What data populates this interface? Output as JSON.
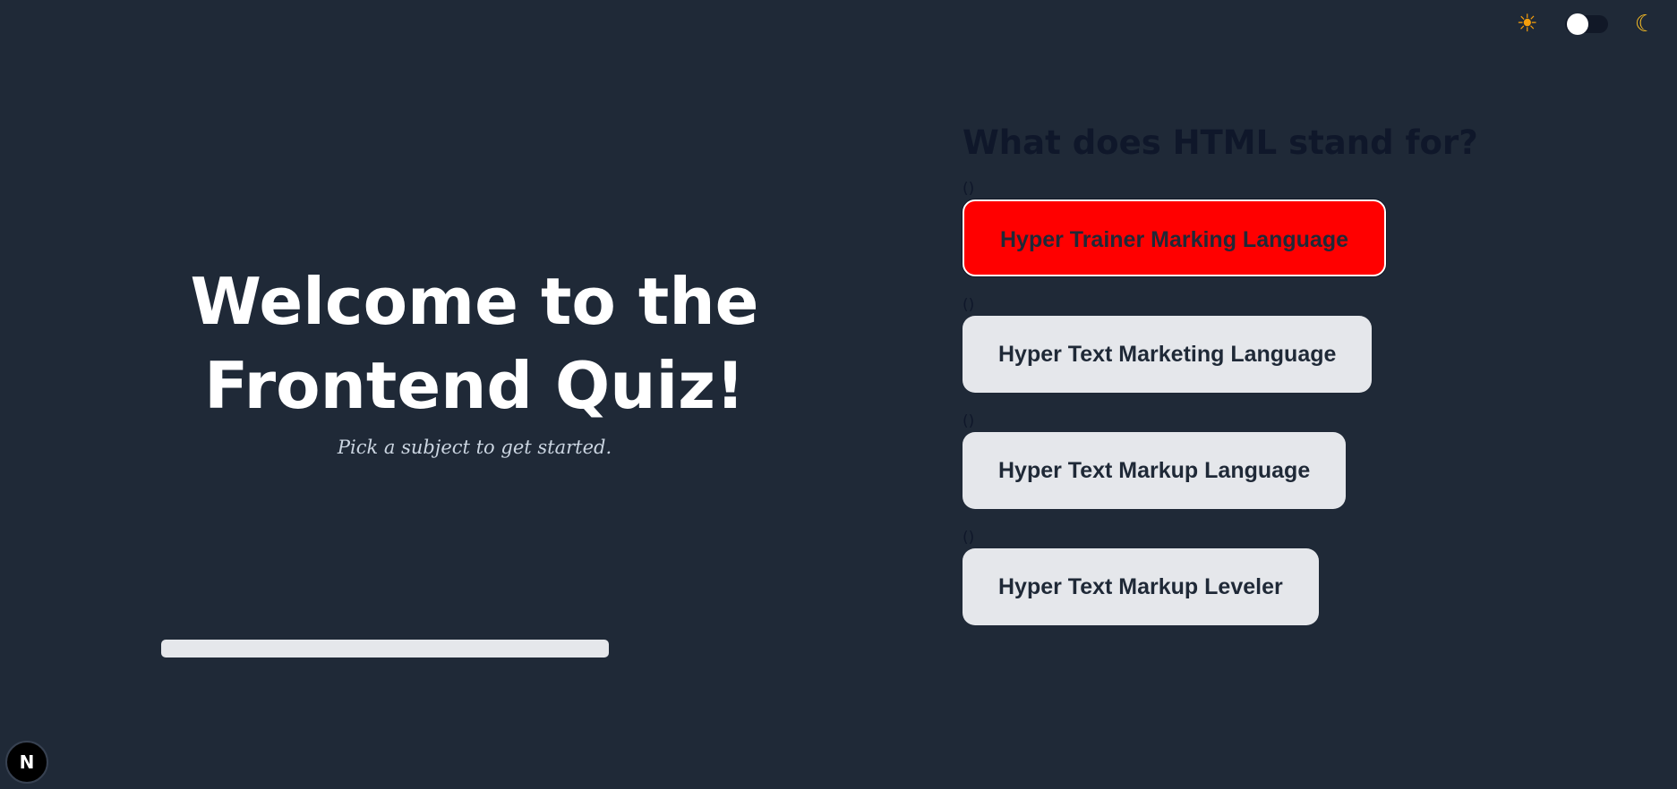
{
  "theme_toggle": {
    "sun_icon": "☀",
    "moon_icon": "☾",
    "dark_mode": false
  },
  "welcome": {
    "title_line1": "Welcome to the",
    "title_line2": "Frontend Quiz!",
    "subtitle": "Pick a subject to get started."
  },
  "progress": {
    "value": 0
  },
  "quiz": {
    "question": "What does HTML stand for?",
    "options": [
      {
        "label": "()",
        "text": "Hyper Trainer Marking Language",
        "state": "wrong"
      },
      {
        "label": "()",
        "text": "Hyper Text Marketing Language",
        "state": "default"
      },
      {
        "label": "()",
        "text": "Hyper Text Markup Language",
        "state": "default"
      },
      {
        "label": "()",
        "text": "Hyper Text Markup Leveler",
        "state": "default"
      }
    ]
  },
  "next_badge": {
    "text": "N"
  },
  "colors": {
    "background": "#1f2937",
    "wrong": "#ff0000",
    "option_bg": "#e5e7eb"
  }
}
